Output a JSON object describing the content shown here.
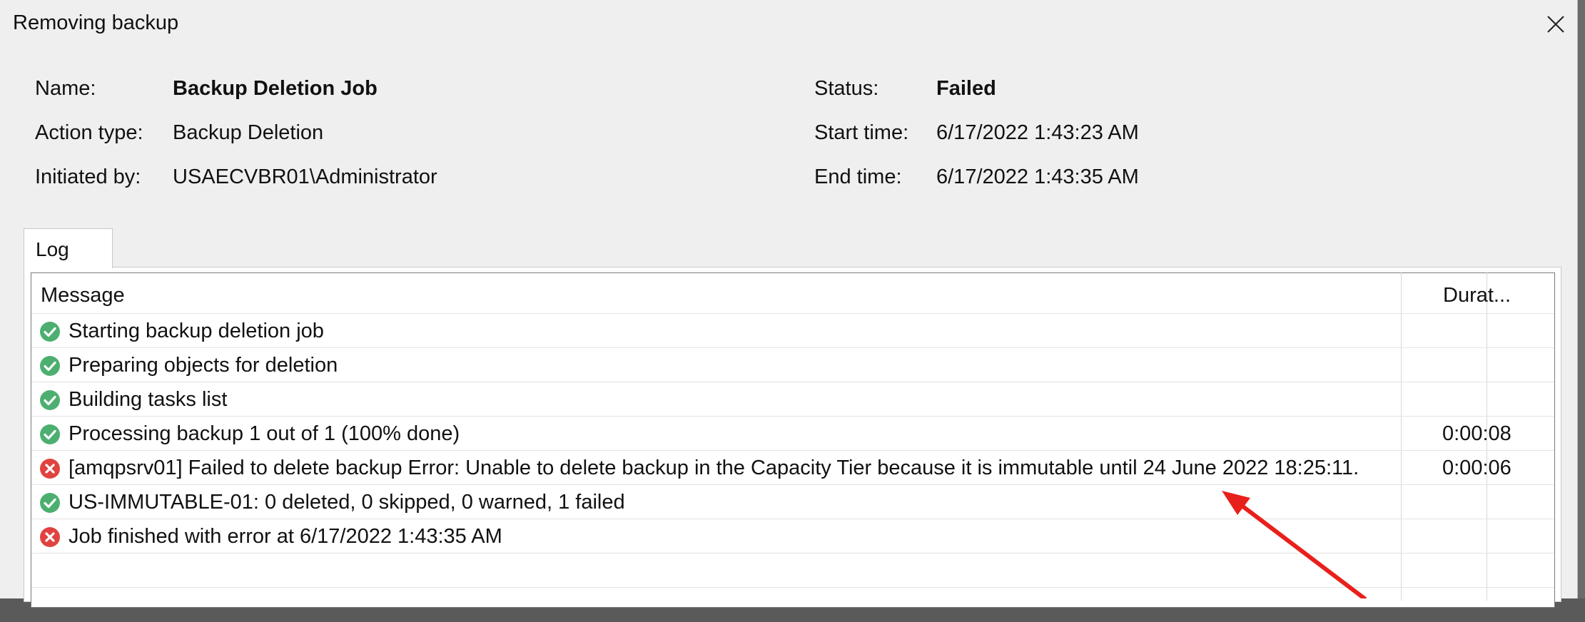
{
  "window": {
    "title": "Removing backup"
  },
  "info": {
    "name_label": "Name:",
    "name_value": "Backup Deletion Job",
    "action_label": "Action type:",
    "action_value": "Backup Deletion",
    "initiated_label": "Initiated by:",
    "initiated_value": "USAECVBR01\\Administrator",
    "status_label": "Status:",
    "status_value": "Failed",
    "start_label": "Start time:",
    "start_value": "6/17/2022 1:43:23 AM",
    "end_label": "End time:",
    "end_value": "6/17/2022 1:43:35 AM"
  },
  "tabs": [
    {
      "label": "Log"
    }
  ],
  "log": {
    "columns": {
      "message": "Message",
      "duration": "Durat..."
    },
    "rows": [
      {
        "status": "success",
        "icon": "check-circle-icon",
        "message": "Starting backup deletion job",
        "duration": ""
      },
      {
        "status": "success",
        "icon": "check-circle-icon",
        "message": "Preparing objects for deletion",
        "duration": ""
      },
      {
        "status": "success",
        "icon": "check-circle-icon",
        "message": "Building tasks list",
        "duration": ""
      },
      {
        "status": "success",
        "icon": "check-circle-icon",
        "message": "Processing backup 1 out of 1 (100% done)",
        "duration": "0:00:08"
      },
      {
        "status": "error",
        "icon": "error-circle-icon",
        "message": "[amqpsrv01] Failed to delete backup Error: Unable to delete backup in the Capacity Tier because it is immutable until  24 June 2022 18:25:11.",
        "duration": "0:00:06"
      },
      {
        "status": "success",
        "icon": "check-circle-icon",
        "message": "US-IMMUTABLE-01: 0 deleted, 0 skipped, 0 warned, 1 failed",
        "duration": ""
      },
      {
        "status": "error",
        "icon": "error-circle-icon",
        "message": "Job finished with error at 6/17/2022 1:43:35 AM",
        "duration": ""
      }
    ]
  },
  "colors": {
    "success": "#4caf70",
    "error": "#e0433f",
    "annotation_arrow": "#e8201c"
  }
}
